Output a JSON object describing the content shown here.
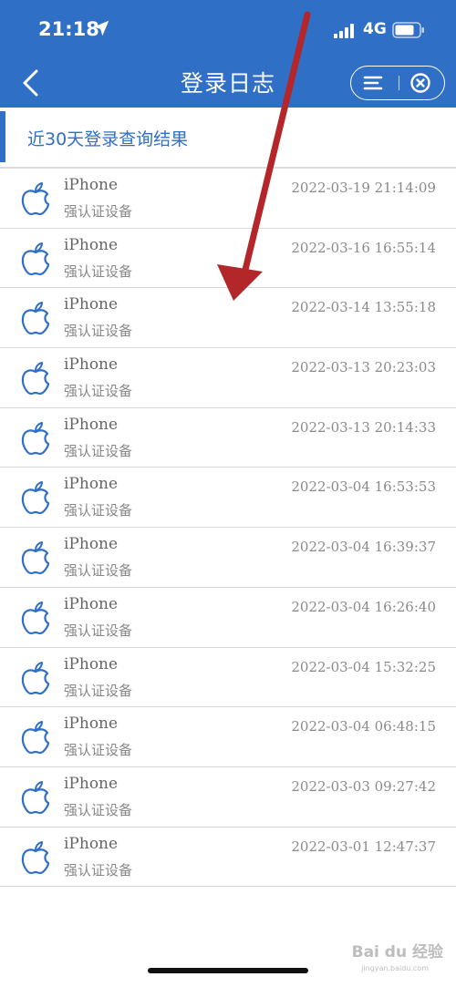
{
  "status_bar": {
    "time": "21:18",
    "network": "4G"
  },
  "nav": {
    "title": "登录日志"
  },
  "section": {
    "title": "近30天登录查询结果"
  },
  "records": [
    {
      "device": "iPhone",
      "type": "强认证设备",
      "time": "2022-03-19 21:14:09"
    },
    {
      "device": "iPhone",
      "type": "强认证设备",
      "time": "2022-03-16 16:55:14"
    },
    {
      "device": "iPhone",
      "type": "强认证设备",
      "time": "2022-03-14 13:55:18"
    },
    {
      "device": "iPhone",
      "type": "强认证设备",
      "time": "2022-03-13 20:23:03"
    },
    {
      "device": "iPhone",
      "type": "强认证设备",
      "time": "2022-03-13 20:14:33"
    },
    {
      "device": "iPhone",
      "type": "强认证设备",
      "time": "2022-03-04 16:53:53"
    },
    {
      "device": "iPhone",
      "type": "强认证设备",
      "time": "2022-03-04 16:39:37"
    },
    {
      "device": "iPhone",
      "type": "强认证设备",
      "time": "2022-03-04 16:26:40"
    },
    {
      "device": "iPhone",
      "type": "强认证设备",
      "time": "2022-03-04 15:32:25"
    },
    {
      "device": "iPhone",
      "type": "强认证设备",
      "time": "2022-03-04 06:48:15"
    },
    {
      "device": "iPhone",
      "type": "强认证设备",
      "time": "2022-03-03 09:27:42"
    },
    {
      "device": "iPhone",
      "type": "强认证设备",
      "time": "2022-03-01 12:47:37"
    }
  ],
  "watermark": {
    "brand": "Bai du 经验",
    "url": "jingyan.baidu.com"
  },
  "colors": {
    "header": "#2f6fc6",
    "accent": "#2f6fc6",
    "arrow": "#b3262a"
  },
  "icons": {
    "back": "chevron-left-icon",
    "menu": "menu-icon",
    "close": "close-circle-icon",
    "device": "apple-icon",
    "location": "location-arrow-icon"
  }
}
